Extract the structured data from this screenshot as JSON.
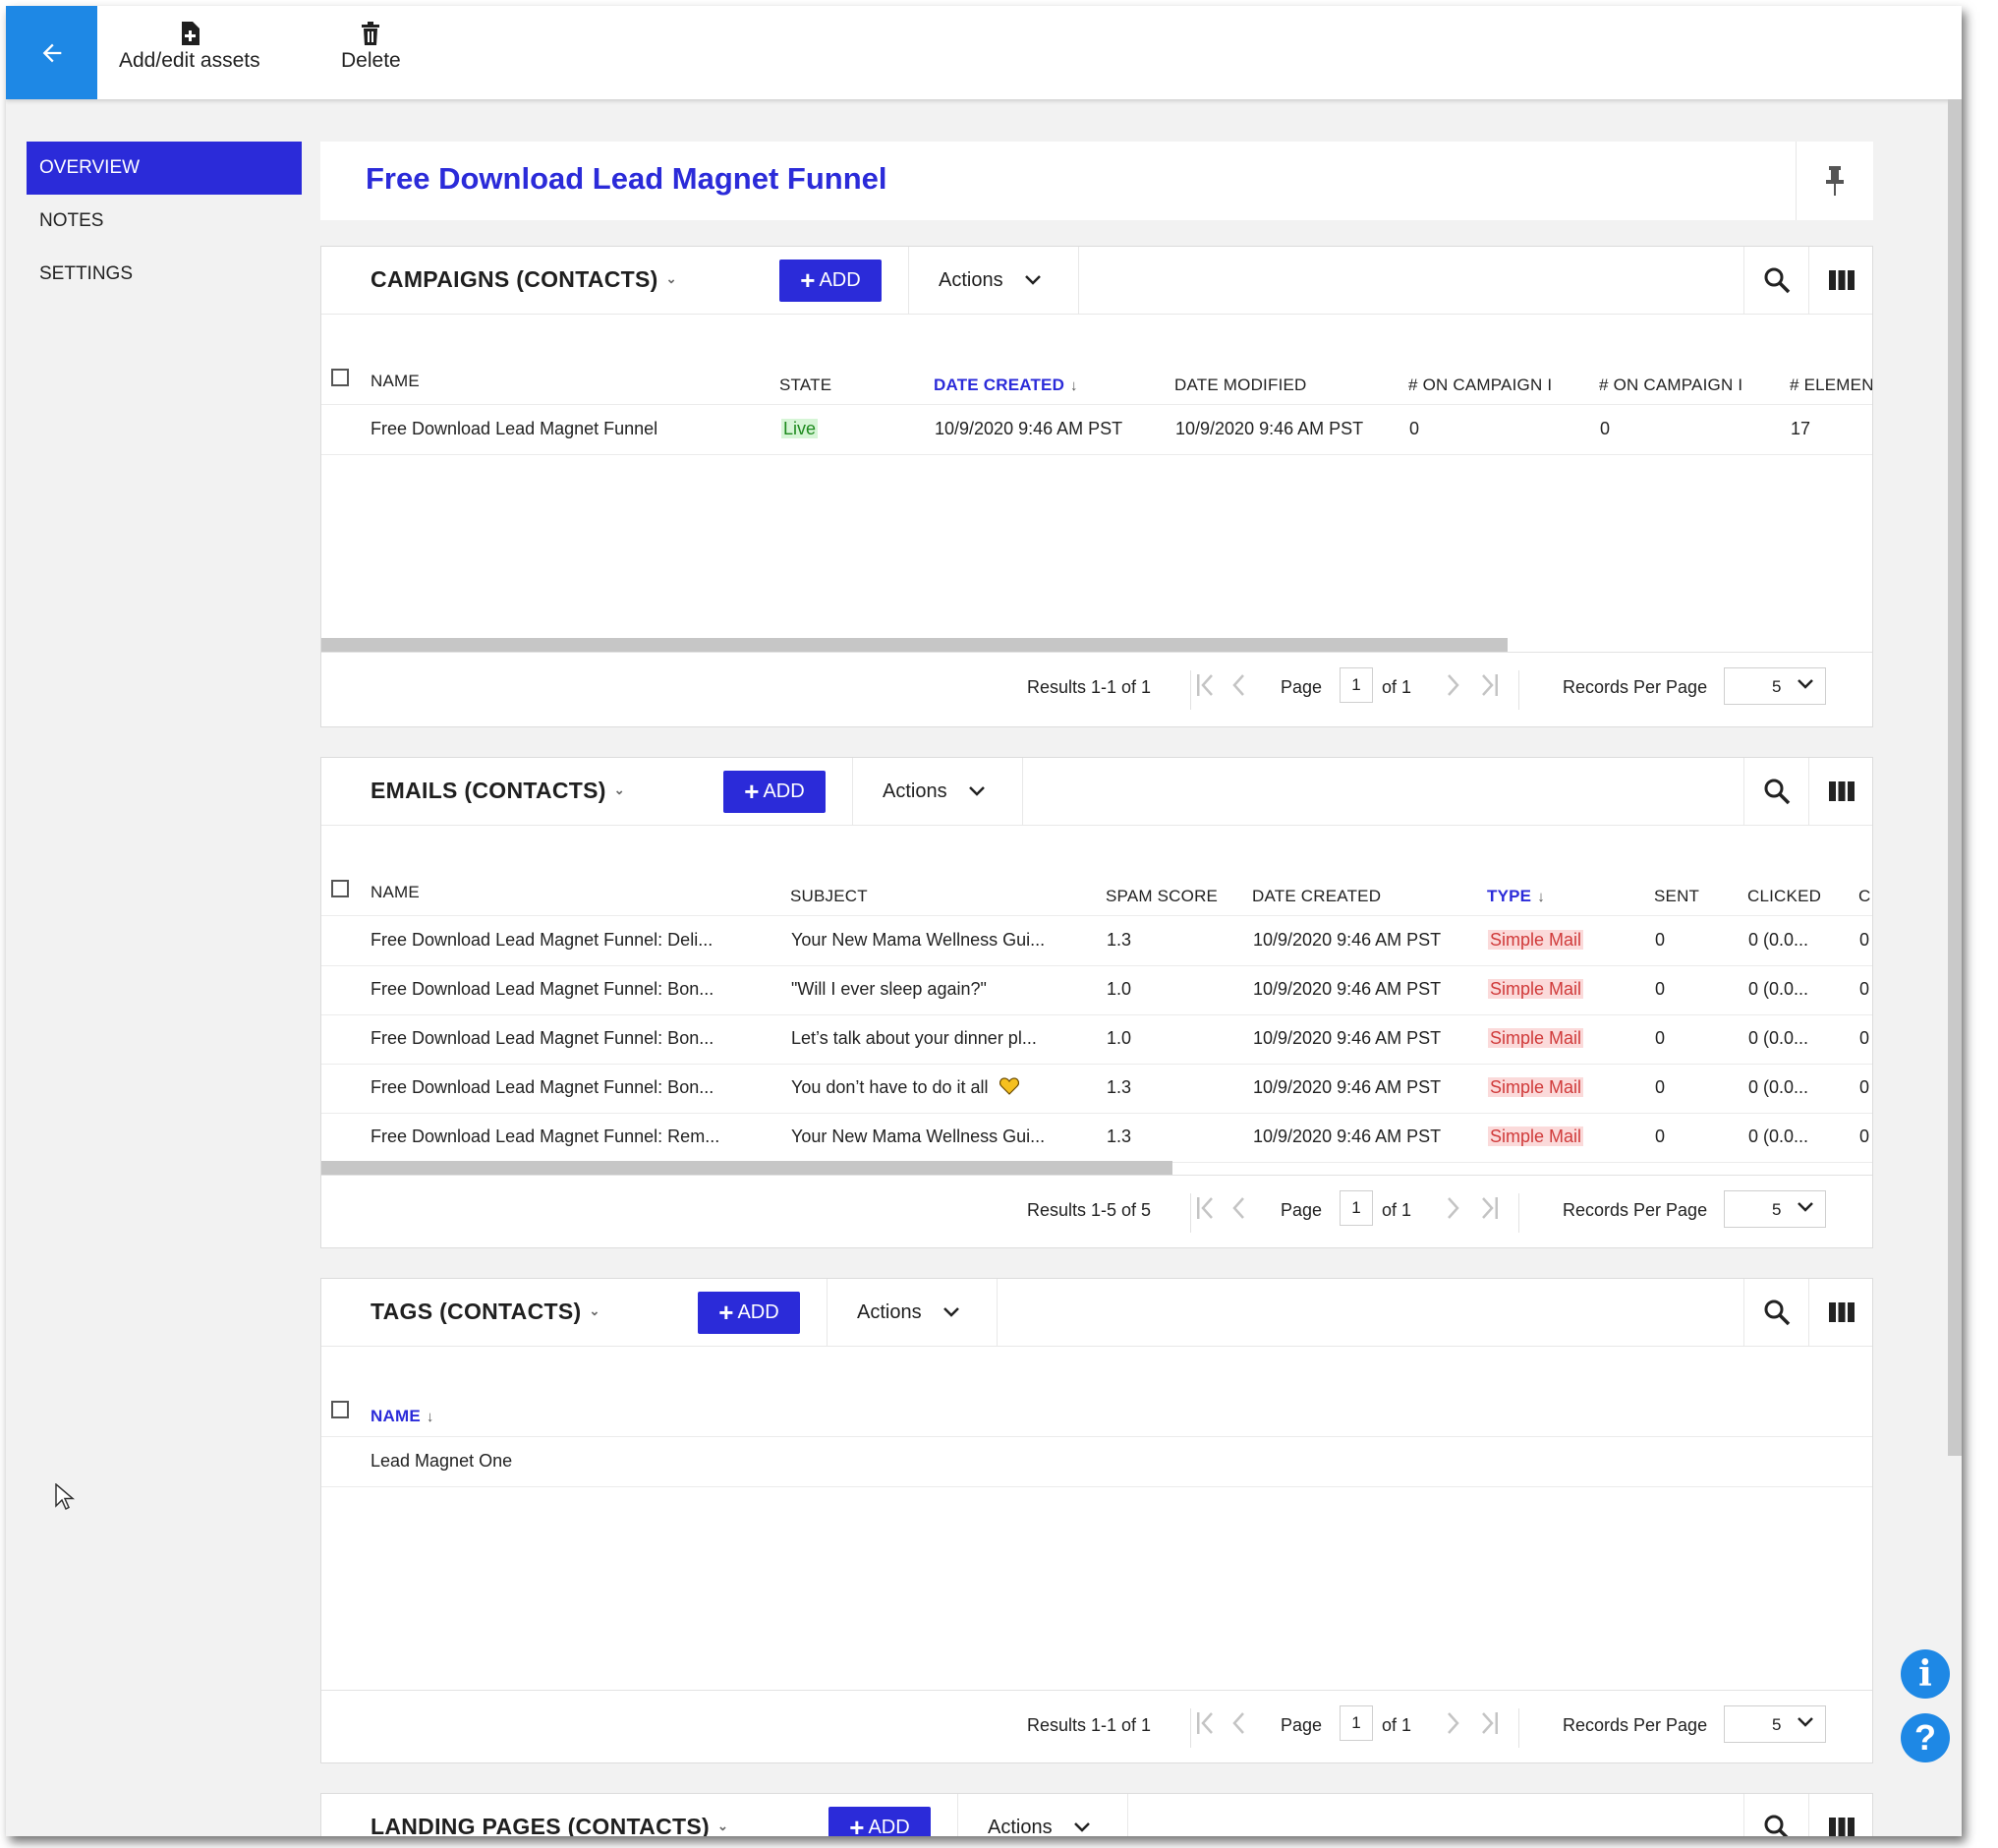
{
  "toolbar": {
    "add_edit_label": "Add/edit assets",
    "delete_label": "Delete"
  },
  "sidenav": {
    "items": [
      "OVERVIEW",
      "NOTES",
      "SETTINGS"
    ]
  },
  "page_title": "Free Download Lead Magnet Funnel",
  "campaigns": {
    "title": "CAMPAIGNS (CONTACTS)",
    "add_label": "ADD",
    "actions_label": "Actions",
    "columns": [
      "NAME",
      "STATE",
      "DATE CREATED",
      "DATE MODIFIED",
      "# ON CAMPAIGN I",
      "# ON CAMPAIGN I",
      "# ELEMEN"
    ],
    "rows": [
      {
        "name": "Free Download Lead Magnet Funnel",
        "state": "Live",
        "created": "10/9/2020 9:46 AM PST",
        "modified": "10/9/2020 9:46 AM PST",
        "on1": "0",
        "on2": "0",
        "elements": "17"
      }
    ],
    "results": "Results 1-1 of 1",
    "page": "1",
    "of": "of 1"
  },
  "emails": {
    "title": "EMAILS (CONTACTS)",
    "add_label": "ADD",
    "actions_label": "Actions",
    "columns": [
      "NAME",
      "SUBJECT",
      "SPAM SCORE",
      "DATE CREATED",
      "TYPE",
      "SENT",
      "CLICKED",
      "C"
    ],
    "rows": [
      {
        "name": "Free Download Lead Magnet Funnel: Deli...",
        "subject": "Your New Mama Wellness Gui...",
        "spam": "1.3",
        "created": "10/9/2020 9:46 AM PST",
        "type": "Simple Mail",
        "sent": "0",
        "clicked": "0 (0.0...",
        "c": "0"
      },
      {
        "name": "Free Download Lead Magnet Funnel: Bon...",
        "subject": "\"Will I ever sleep again?\"",
        "spam": "1.0",
        "created": "10/9/2020 9:46 AM PST",
        "type": "Simple Mail",
        "sent": "0",
        "clicked": "0 (0.0...",
        "c": "0"
      },
      {
        "name": "Free Download Lead Magnet Funnel: Bon...",
        "subject": "Let’s talk about your dinner pl...",
        "spam": "1.0",
        "created": "10/9/2020 9:46 AM PST",
        "type": "Simple Mail",
        "sent": "0",
        "clicked": "0 (0.0...",
        "c": "0"
      },
      {
        "name": "Free Download Lead Magnet Funnel: Bon...",
        "subject": "You don’t have to do it all",
        "spam": "1.3",
        "created": "10/9/2020 9:46 AM PST",
        "type": "Simple Mail",
        "sent": "0",
        "clicked": "0 (0.0...",
        "c": "0"
      },
      {
        "name": "Free Download Lead Magnet Funnel: Rem...",
        "subject": "Your New Mama Wellness Gui...",
        "spam": "1.3",
        "created": "10/9/2020 9:46 AM PST",
        "type": "Simple Mail",
        "sent": "0",
        "clicked": "0 (0.0...",
        "c": "0"
      }
    ],
    "results": "Results 1-5 of 5",
    "page": "1",
    "of": "of 1"
  },
  "tags": {
    "title": "TAGS (CONTACTS)",
    "add_label": "ADD",
    "actions_label": "Actions",
    "columns": [
      "NAME"
    ],
    "rows": [
      {
        "name": "Lead Magnet One"
      }
    ],
    "results": "Results 1-1 of 1",
    "page": "1",
    "of": "of 1"
  },
  "landing": {
    "title": "LANDING PAGES (CONTACTS)",
    "add_label": "ADD",
    "actions_label": "Actions"
  },
  "pagination": {
    "page_label": "Page",
    "rpp_label": "Records Per Page",
    "rpp_value": "5"
  },
  "colors": {
    "accent": "#2b2bd9",
    "brand_blue": "#1e88e5",
    "live_bg": "#d6f5d6",
    "mail_bg": "#fbdada"
  }
}
